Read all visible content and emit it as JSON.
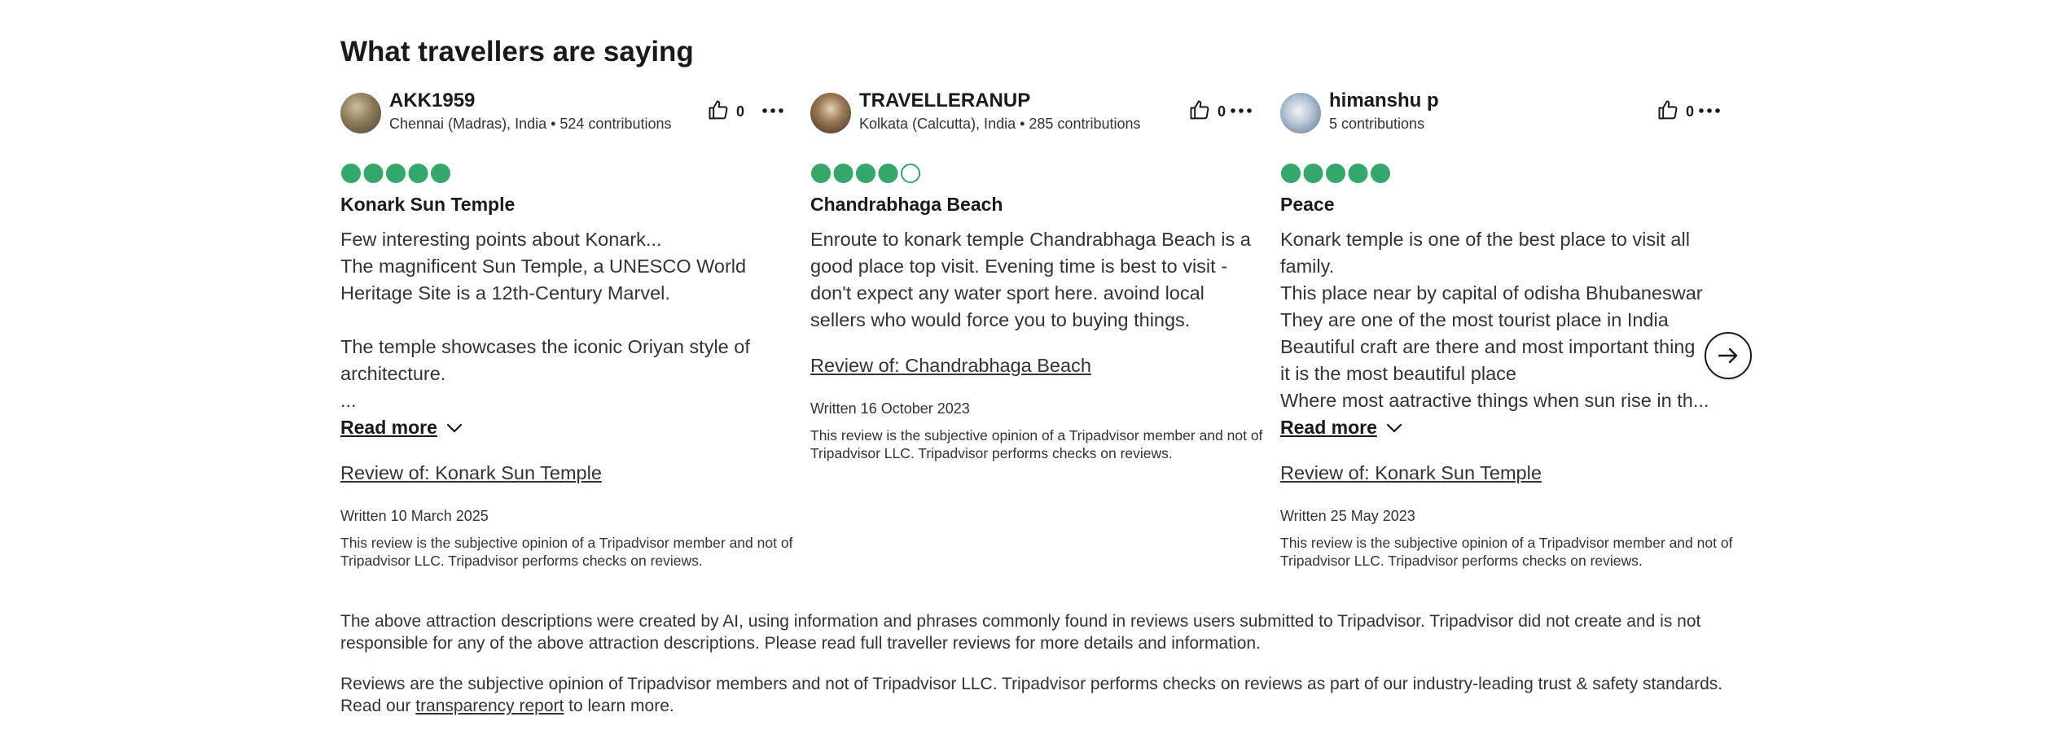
{
  "section": {
    "title": "What travellers are saying"
  },
  "colors": {
    "rating_green": "#34a86b",
    "text_dark": "#1a1a1a",
    "text_body": "#333333"
  },
  "icons": {
    "helpful": "thumbs-up-icon",
    "more": "more-options-icon",
    "read_more": "chevron-down-icon",
    "next": "arrow-right-icon"
  },
  "reviews": [
    {
      "username": "AKK1959",
      "location_contributions": "Chennai (Madras), India • 524 contributions",
      "helpful_count": "0",
      "rating": 5,
      "title": "Konark Sun Temple",
      "body": "Few interesting points about Konark...\nThe magnificent Sun Temple, a UNESCO World Heritage Site is a 12th-Century Marvel.\n\nThe temple showcases the iconic Oriyan style of architecture.\n...",
      "read_more": "Read more",
      "review_of": "Review of: Konark Sun Temple",
      "written": "Written 10 March 2025",
      "disclaimer": "This review is the subjective opinion of a Tripadvisor member and not of Tripadvisor LLC. Tripadvisor performs checks on reviews."
    },
    {
      "username": "TRAVELLERANUP",
      "location_contributions": "Kolkata (Calcutta), India • 285 contributions",
      "helpful_count": "0",
      "rating": 4,
      "title": "Chandrabhaga Beach",
      "body": "Enroute to konark temple Chandrabhaga Beach is a good place top visit. Evening time is best to visit - don't expect any water sport here. avoind local sellers who would force you to buying things.",
      "review_of": "Review of: Chandrabhaga Beach",
      "written": "Written 16 October 2023",
      "disclaimer": "This review is the subjective opinion of a Tripadvisor member and not of Tripadvisor LLC. Tripadvisor performs checks on reviews."
    },
    {
      "username": "himanshu p",
      "location_contributions": "5 contributions",
      "helpful_count": "0",
      "rating": 5,
      "title": "Peace",
      "body": "Konark temple is one of the best place to visit all family.\nThis place near by capital of odisha Bhubaneswar\nThey are one of the most tourist place in India\nBeautiful craft are there and most important thing\nit is the most beautiful place\nWhere most aatractive things when sun rise in th...",
      "read_more": "Read more",
      "review_of": "Review of: Konark Sun Temple",
      "written": "Written 25 May 2023",
      "disclaimer": "This review is the subjective opinion of a Tripadvisor member and not of Tripadvisor LLC. Tripadvisor performs checks on reviews."
    }
  ],
  "footer": {
    "ai_notice": "The above attraction descriptions were created by AI, using information and phrases commonly found in reviews users submitted to Tripadvisor. Tripadvisor did not create and is not responsible for any of the above attraction descriptions. Please read full traveller reviews for more details and information.",
    "reviews_notice_before": "Reviews are the subjective opinion of Tripadvisor members and not of Tripadvisor LLC. Tripadvisor performs checks on reviews as part of our industry-leading trust & safety standards. Read our ",
    "reviews_notice_link": "transparency report",
    "reviews_notice_after": " to learn more."
  }
}
